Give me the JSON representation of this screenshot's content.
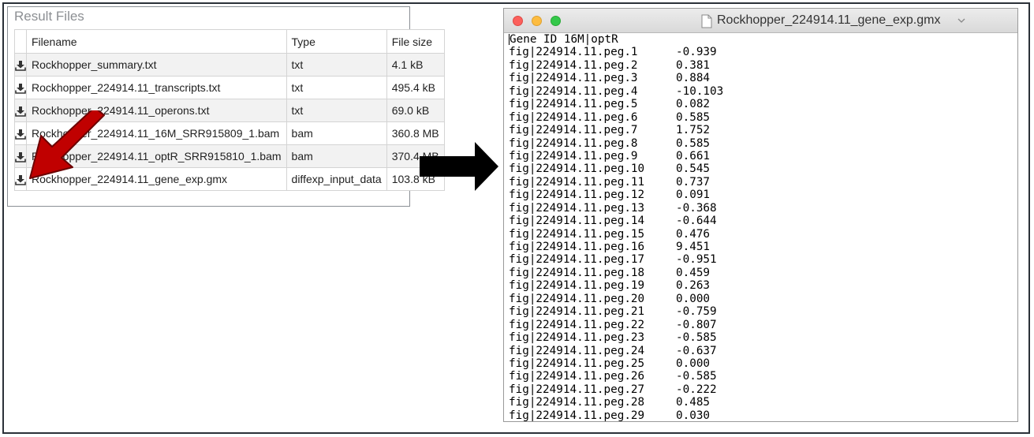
{
  "result_files": {
    "title": "Result Files",
    "headers": {
      "filename": "Filename",
      "type": "Type",
      "size": "File size"
    },
    "rows": [
      {
        "name": "Rockhopper_summary.txt",
        "type": "txt",
        "size": "4.1 kB"
      },
      {
        "name": "Rockhopper_224914.11_transcripts.txt",
        "type": "txt",
        "size": "495.4 kB"
      },
      {
        "name": "Rockhopper_224914.11_operons.txt",
        "type": "txt",
        "size": "69.0 kB"
      },
      {
        "name": "Rockhopper_224914.11_16M_SRR915809_1.bam",
        "type": "bam",
        "size": "360.8 MB"
      },
      {
        "name": "Rockhopper_224914.11_optR_SRR915810_1.bam",
        "type": "bam",
        "size": "370.4 MB"
      },
      {
        "name": "Rockhopper_224914.11_gene_exp.gmx",
        "type": "diffexp_input_data",
        "size": "103.8 kB"
      }
    ]
  },
  "window": {
    "title": "Rockhopper_224914.11_gene_exp.gmx",
    "header_line": "Gene ID 16M|optR",
    "lines": [
      {
        "id": "fig|224914.11.peg.1",
        "value": "-0.939"
      },
      {
        "id": "fig|224914.11.peg.2",
        "value": "0.381"
      },
      {
        "id": "fig|224914.11.peg.3",
        "value": "0.884"
      },
      {
        "id": "fig|224914.11.peg.4",
        "value": "-10.103"
      },
      {
        "id": "fig|224914.11.peg.5",
        "value": "0.082"
      },
      {
        "id": "fig|224914.11.peg.6",
        "value": "0.585"
      },
      {
        "id": "fig|224914.11.peg.7",
        "value": "1.752"
      },
      {
        "id": "fig|224914.11.peg.8",
        "value": "0.585"
      },
      {
        "id": "fig|224914.11.peg.9",
        "value": "0.661"
      },
      {
        "id": "fig|224914.11.peg.10",
        "value": "0.545"
      },
      {
        "id": "fig|224914.11.peg.11",
        "value": "0.737"
      },
      {
        "id": "fig|224914.11.peg.12",
        "value": "0.091"
      },
      {
        "id": "fig|224914.11.peg.13",
        "value": "-0.368"
      },
      {
        "id": "fig|224914.11.peg.14",
        "value": "-0.644"
      },
      {
        "id": "fig|224914.11.peg.15",
        "value": "0.476"
      },
      {
        "id": "fig|224914.11.peg.16",
        "value": "9.451"
      },
      {
        "id": "fig|224914.11.peg.17",
        "value": "-0.951"
      },
      {
        "id": "fig|224914.11.peg.18",
        "value": "0.459"
      },
      {
        "id": "fig|224914.11.peg.19",
        "value": "0.263"
      },
      {
        "id": "fig|224914.11.peg.20",
        "value": "0.000"
      },
      {
        "id": "fig|224914.11.peg.21",
        "value": "-0.759"
      },
      {
        "id": "fig|224914.11.peg.22",
        "value": "-0.807"
      },
      {
        "id": "fig|224914.11.peg.23",
        "value": "-0.585"
      },
      {
        "id": "fig|224914.11.peg.24",
        "value": "-0.637"
      },
      {
        "id": "fig|224914.11.peg.25",
        "value": "0.000"
      },
      {
        "id": "fig|224914.11.peg.26",
        "value": "-0.585"
      },
      {
        "id": "fig|224914.11.peg.27",
        "value": "-0.222"
      },
      {
        "id": "fig|224914.11.peg.28",
        "value": "0.485"
      },
      {
        "id": "fig|224914.11.peg.29",
        "value": "0.030"
      }
    ]
  },
  "icons": {
    "download": "download-icon",
    "red_arrow": "red-arrow-icon",
    "black_arrow": "black-arrow-icon",
    "document": "document-icon",
    "chevron": "chevron-down-icon"
  },
  "colors": {
    "red_arrow": "#c00000",
    "traffic_red": "#fc605c",
    "traffic_yellow": "#fdbc40",
    "traffic_green": "#34c84a"
  }
}
